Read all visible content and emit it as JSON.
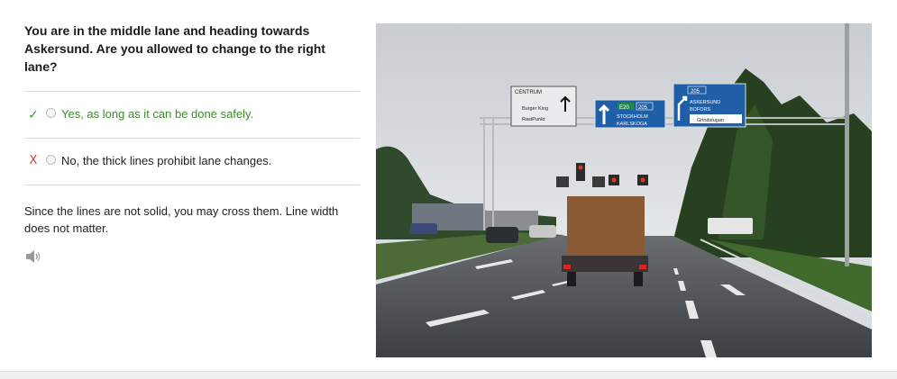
{
  "question": "You are in the middle lane and heading towards Askersund. Are you allowed to change to the right lane?",
  "answers": [
    {
      "mark": "✓",
      "text": "Yes, as long as it can be done safely.",
      "status": "correct"
    },
    {
      "mark": "X",
      "text": "No, the thick lines prohibit lane changes.",
      "status": "wrong"
    }
  ],
  "explanation": "Since the lines are not solid, you may cross them. Line width does not matter.",
  "audio_icon": "speaker-icon",
  "photo": {
    "sign_left": {
      "header": "CENTRUM",
      "line1": "Burger King",
      "line2": "RastPunkt"
    },
    "sign_middle": {
      "route1": "E20",
      "route2": "205",
      "line1": "STOCKHOLM",
      "line2": "KARLSKOGA"
    },
    "sign_right": {
      "route": "205",
      "line1": "ASKERSUND",
      "line2": "BOFORS",
      "line3": "Grindstugan"
    }
  },
  "colors": {
    "correct": "#3d8b2a",
    "wrong": "#d43a3a",
    "sign_blue": "#1f5fa8",
    "sign_green": "#1e8a4a"
  }
}
